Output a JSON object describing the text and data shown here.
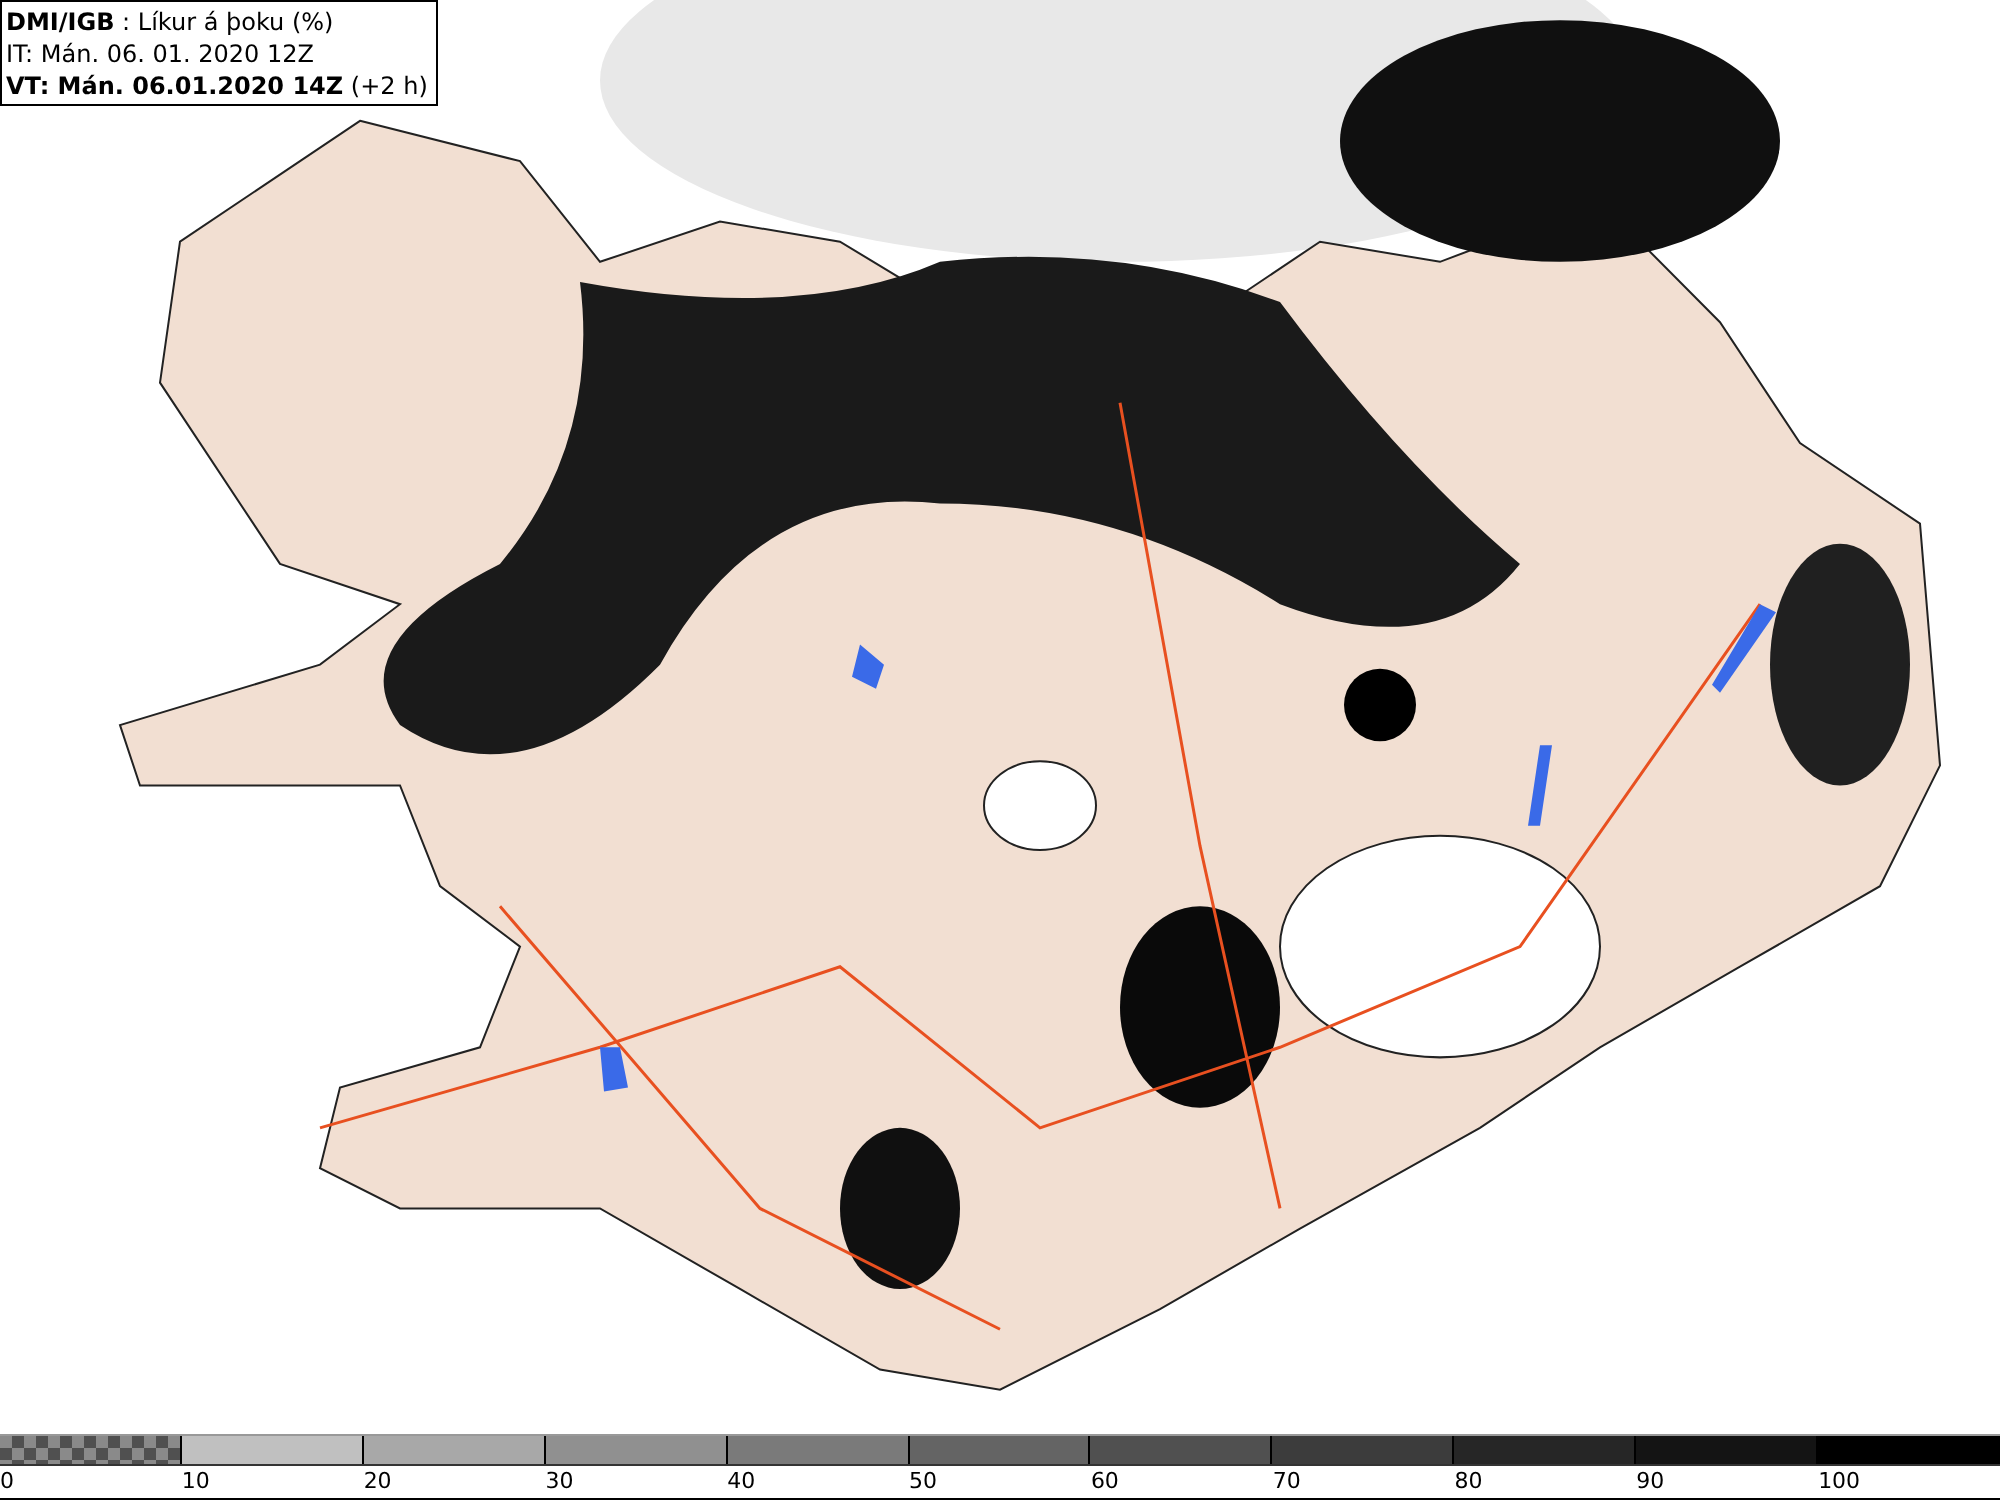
{
  "header": {
    "source": "DMI/IGB",
    "parameter": ": Líkur á þoku (%)",
    "initial_time": "IT: Mán. 06. 01. 2020 12Z",
    "valid_time": "VT: Mán. 06.01.2020 14Z",
    "offset": "(+2 h)"
  },
  "legend": {
    "bins": [
      {
        "kind": "checker",
        "color": "#505050"
      },
      {
        "kind": "solid",
        "color": "#c0c0c0"
      },
      {
        "kind": "solid",
        "color": "#a8a8a8"
      },
      {
        "kind": "solid",
        "color": "#909090"
      },
      {
        "kind": "solid",
        "color": "#7a7a7a"
      },
      {
        "kind": "solid",
        "color": "#646464"
      },
      {
        "kind": "solid",
        "color": "#505050"
      },
      {
        "kind": "solid",
        "color": "#3c3c3c"
      },
      {
        "kind": "solid",
        "color": "#262626"
      },
      {
        "kind": "solid",
        "color": "#141414"
      },
      {
        "kind": "solid",
        "color": "#000000"
      }
    ],
    "labels": [
      "0",
      "10",
      "20",
      "30",
      "40",
      "50",
      "60",
      "70",
      "80",
      "90",
      "100"
    ]
  }
}
